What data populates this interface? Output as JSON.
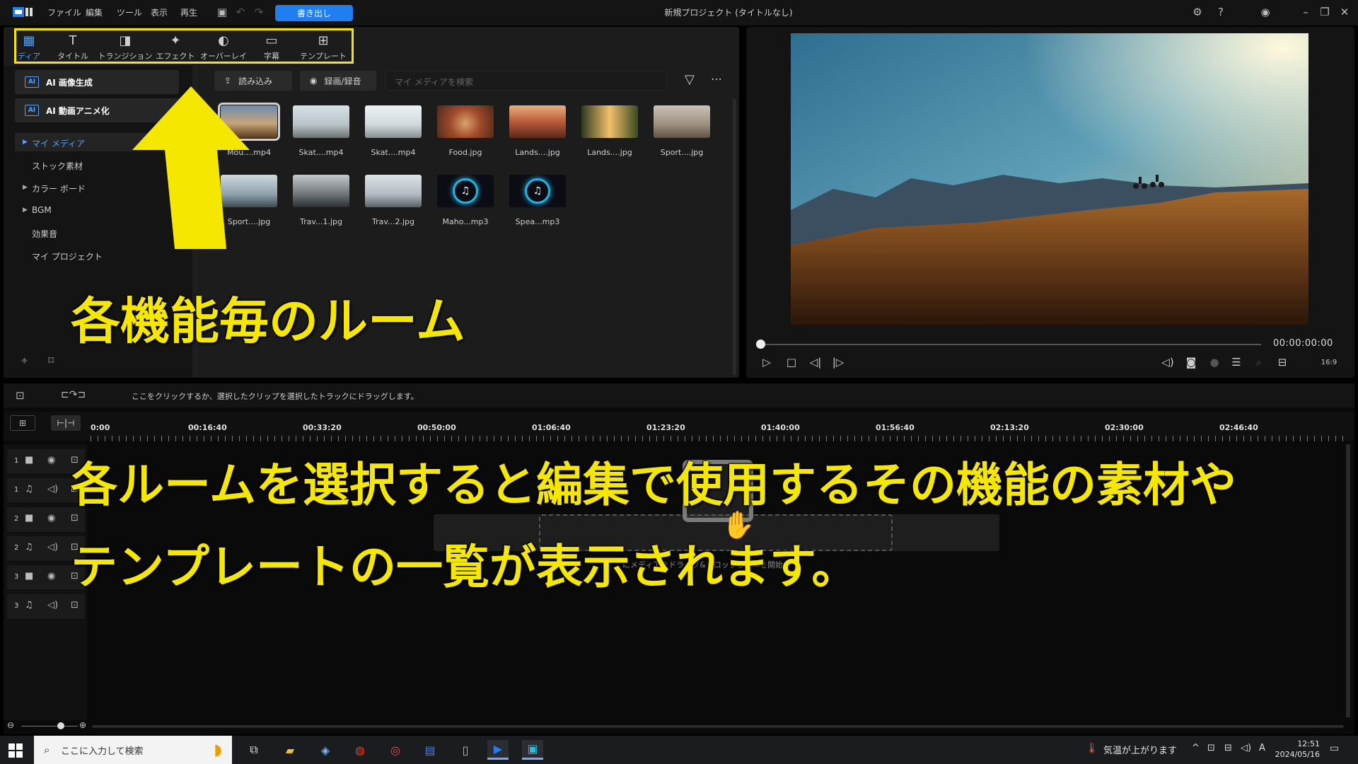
{
  "app": {
    "window_title": "新規プロジェクト (タイトルなし)",
    "menu": [
      "ファイル",
      "編集",
      "ツール",
      "表示",
      "再生"
    ],
    "export_label": "書き出し",
    "accent_color": "#1f7ff0"
  },
  "room_tabs": [
    {
      "label": "ディア",
      "icon": "media-room-icon"
    },
    {
      "label": "タイトル",
      "icon": "title-room-icon"
    },
    {
      "label": "トランジション",
      "icon": "transition-room-icon"
    },
    {
      "label": "エフェクト",
      "icon": "effect-room-icon"
    },
    {
      "label": "オーバーレイ",
      "icon": "overlay-room-icon"
    },
    {
      "label": "字幕",
      "icon": "subtitle-room-icon"
    },
    {
      "label": "テンプレート",
      "icon": "template-room-icon"
    }
  ],
  "sidebar": {
    "ai_image": "AI 画像生成",
    "ai_anime": "AI 動画アニメ化",
    "ai_badge": "AI",
    "tree": [
      {
        "label": "マイ メディア",
        "expandable": true,
        "selected": true
      },
      {
        "label": "ストック素材",
        "expandable": false
      },
      {
        "label": "カラー ボード",
        "expandable": true
      },
      {
        "label": "BGM",
        "expandable": true
      },
      {
        "label": "効果音",
        "expandable": false
      },
      {
        "label": "マイ プロジェクト",
        "expandable": false
      }
    ]
  },
  "library": {
    "import_label": "読み込み",
    "record_label": "録画/録音",
    "search_placeholder": "マイ メディアを検索",
    "media": [
      {
        "name": "Mou....mp4",
        "kind": "video",
        "selected": true
      },
      {
        "name": "Skat....mp4",
        "kind": "video"
      },
      {
        "name": "Skat....mp4",
        "kind": "video"
      },
      {
        "name": "Food.jpg",
        "kind": "image"
      },
      {
        "name": "Lands....jpg",
        "kind": "image"
      },
      {
        "name": "Lands....jpg",
        "kind": "image"
      },
      {
        "name": "Sport....jpg",
        "kind": "image"
      },
      {
        "name": "Sport....jpg",
        "kind": "image"
      },
      {
        "name": "Trav...1.jpg",
        "kind": "image"
      },
      {
        "name": "Trav...2.jpg",
        "kind": "image"
      },
      {
        "name": "Maho...mp3",
        "kind": "audio"
      },
      {
        "name": "Spea...mp3",
        "kind": "audio"
      }
    ]
  },
  "preview": {
    "timecode": "00:00:00:00",
    "aspect": "16:9",
    "progress": 0
  },
  "timeline": {
    "hint": "ここをクリックするか、選択したクリップを選択したトラックにドラッグします。",
    "ruler": [
      "0:00",
      "00:16:40",
      "00:33:20",
      "00:50:00",
      "01:06:40",
      "01:23:20",
      "01:40:00",
      "01:56:40",
      "02:13:20",
      "02:30:00",
      "02:46:40"
    ],
    "tracks": [
      {
        "num": "1",
        "type": "video"
      },
      {
        "num": "1",
        "type": "audio"
      },
      {
        "num": "2",
        "type": "video"
      },
      {
        "num": "2",
        "type": "audio"
      },
      {
        "num": "3",
        "type": "video"
      },
      {
        "num": "3",
        "type": "audio"
      }
    ],
    "drop_text": "にメディアをドラッグ&ドロップして...を開始し"
  },
  "overlay": {
    "line1": "各機能毎のルーム",
    "line2": "各ルームを選択すると編集で使用するその機能の素材や",
    "line3": "テンプレートの一覧が表示されます。",
    "color": "#f5e700"
  },
  "taskbar": {
    "search_placeholder": "ここに入力して検索",
    "weather": "気温が上がります",
    "time": "12:51",
    "date": "2024/05/16"
  }
}
